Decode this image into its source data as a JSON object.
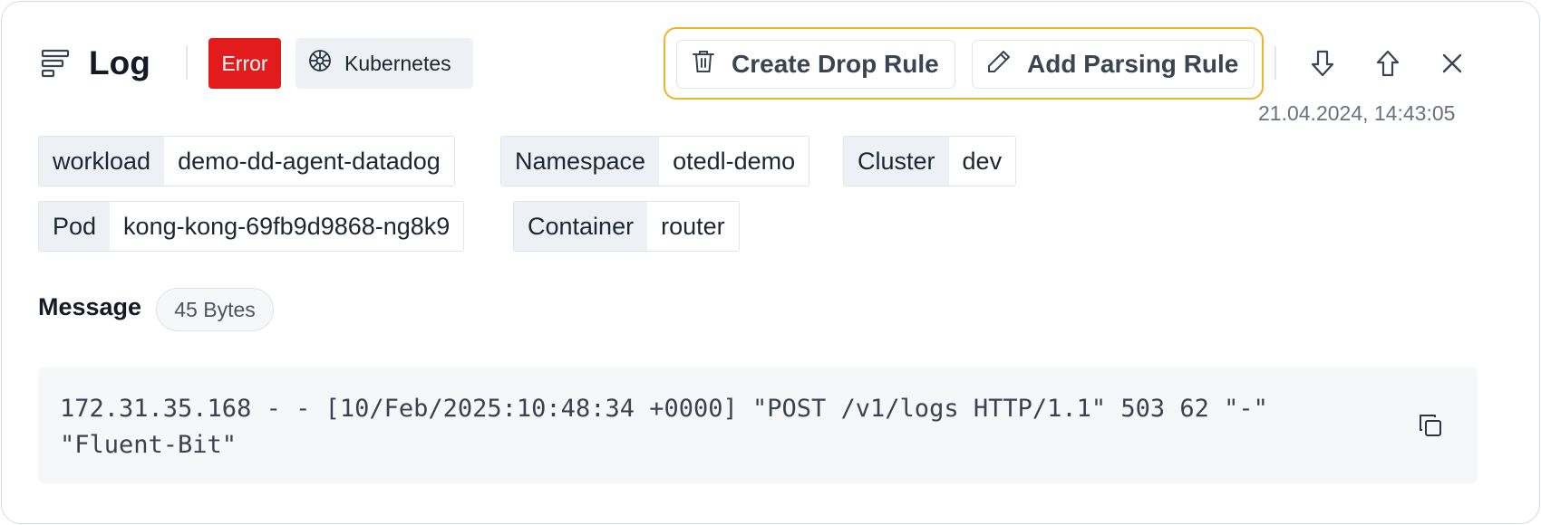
{
  "header": {
    "title": "Log",
    "level_badge": "Error",
    "source_badge": "Kubernetes",
    "timestamp": "21.04.2024, 14:43:05"
  },
  "actions": {
    "create_drop_rule": "Create Drop Rule",
    "add_parsing_rule": "Add Parsing Rule"
  },
  "tags": [
    {
      "key": "workload",
      "value": "demo-dd-agent-datadog"
    },
    {
      "key": "Namespace",
      "value": "otedl-demo"
    },
    {
      "key": "Cluster",
      "value": "dev"
    },
    {
      "key": "Pod",
      "value": "kong-kong-69fb9d9868-ng8k9"
    },
    {
      "key": "Container",
      "value": "router"
    }
  ],
  "message": {
    "label": "Message",
    "size": "45 Bytes",
    "text": "172.31.35.168 - - [10/Feb/2025:10:48:34 +0000] \"POST /v1/logs HTTP/1.1\" 503 62 \"-\" \"Fluent-Bit\""
  },
  "colors": {
    "error": "#e21c1c",
    "highlight_border": "#f0b328",
    "tag_key_bg": "#edf0f4"
  },
  "icons": {
    "log": "log-lines-icon",
    "kubernetes": "kubernetes-helm-icon",
    "trash": "trash-icon",
    "pencil": "pencil-icon",
    "down": "arrow-down-icon",
    "up": "arrow-up-icon",
    "close": "close-icon",
    "copy": "copy-icon"
  }
}
